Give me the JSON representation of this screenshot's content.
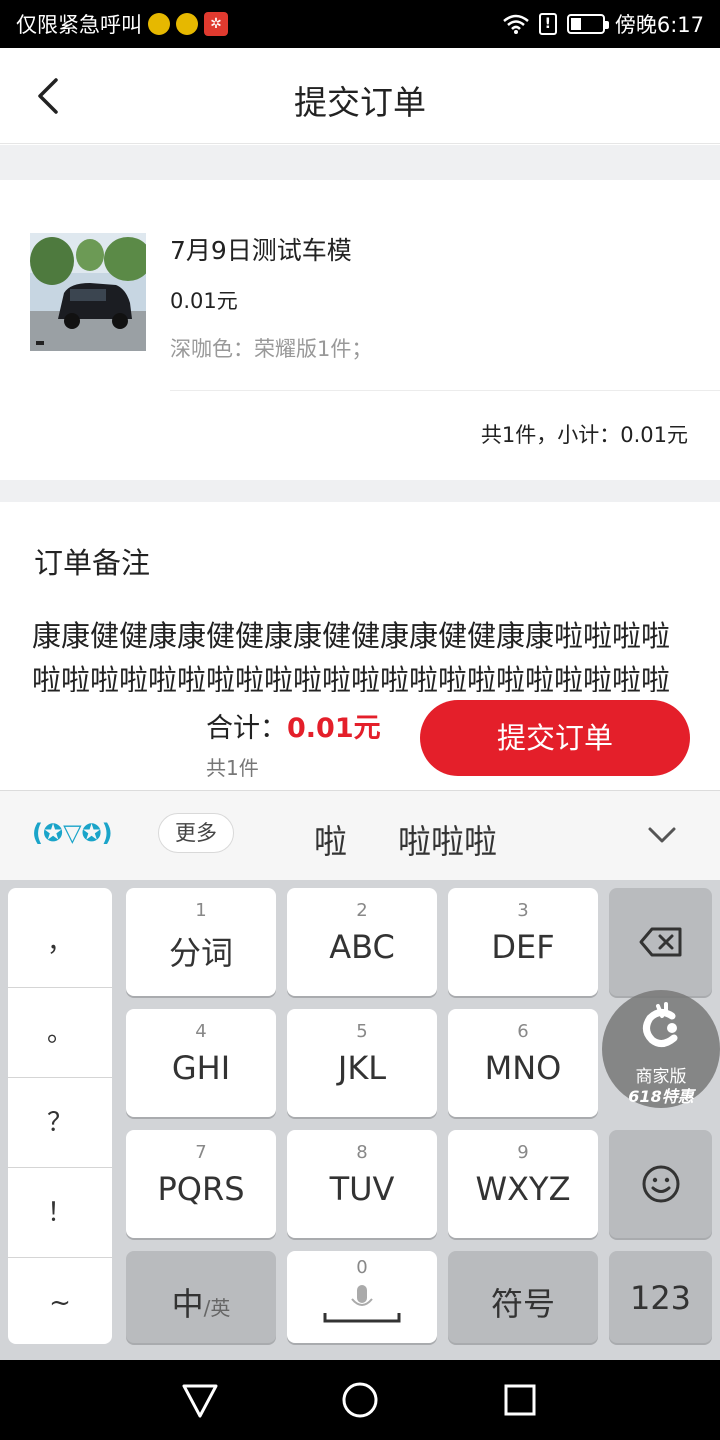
{
  "status_bar": {
    "left_text": "仅限紧急呼叫",
    "time": "傍晚6:17",
    "battery_level": 0.35,
    "sim_alert": "!"
  },
  "header": {
    "title": "提交订单",
    "back_icon": "chevron-left-icon"
  },
  "product": {
    "name": "7月9日测试车模",
    "price": "0.01元",
    "spec": "深咖色：荣耀版1件；",
    "subtotal": "共1件，小计：0.01元"
  },
  "remark": {
    "title": "订单备注",
    "text": "康康健健康康健健康康健健康康健健康康啦啦啦啦啦啦啦啦啦啦啦啦啦啦啦啦啦啦啦啦啦啦啦啦啦啦啦"
  },
  "footer": {
    "total_label": "合计：",
    "total_amount": "0.01元",
    "count": "共1件",
    "submit_label": "提交订单"
  },
  "ime": {
    "emoticon": "(✪▽✪)",
    "more": "更多",
    "candidates": [
      "啦",
      "啦啦啦"
    ],
    "collapse_icon": "chevron-down-icon"
  },
  "keyboard": {
    "punctuation": [
      "，",
      "。",
      "？",
      "！",
      "~"
    ],
    "keys": [
      {
        "num": "1",
        "label": "分词"
      },
      {
        "num": "2",
        "label": "ABC"
      },
      {
        "num": "3",
        "label": "DEF"
      },
      {
        "num": "4",
        "label": "GHI"
      },
      {
        "num": "5",
        "label": "JKL"
      },
      {
        "num": "6",
        "label": "MNO"
      },
      {
        "num": "7",
        "label": "PQRS"
      },
      {
        "num": "8",
        "label": "TUV"
      },
      {
        "num": "9",
        "label": "WXYZ"
      }
    ],
    "lang_main": "中",
    "lang_sub": "/英",
    "space_num": "0",
    "symbols": "符号",
    "numbers": "123"
  },
  "badge": {
    "line1": "商家版",
    "line2": "618特惠"
  },
  "colors": {
    "accent_red": "#e41f2a",
    "ime_accent": "#1aa4c9"
  }
}
